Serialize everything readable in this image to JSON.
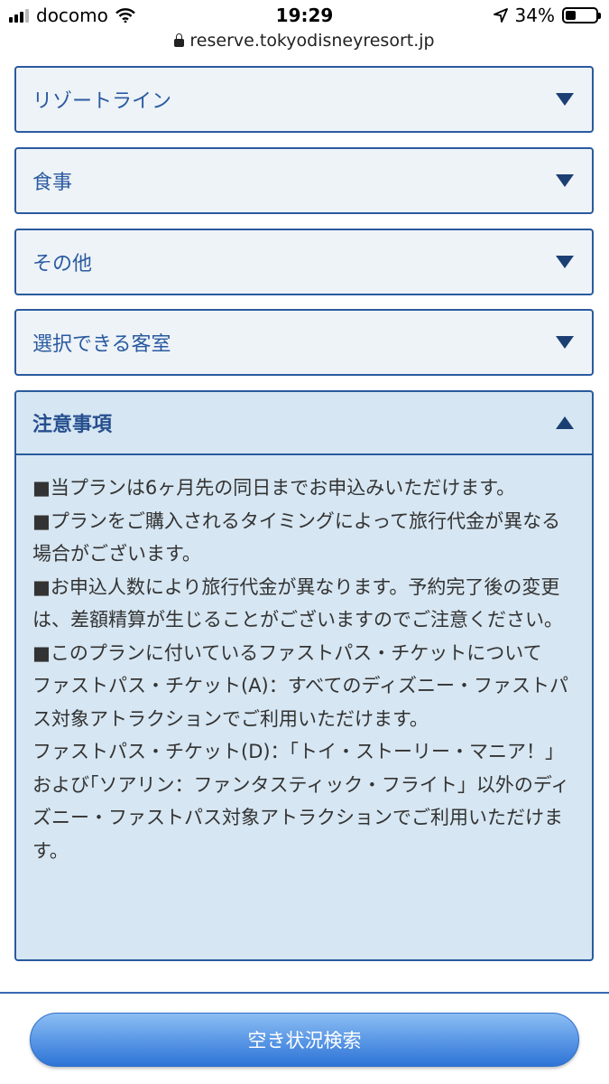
{
  "status_bar": {
    "carrier": "docomo",
    "time": "19:29",
    "battery": "34%",
    "battery_level": 0.34
  },
  "url_bar": {
    "url": "reserve.tokyodisneyresort.jp"
  },
  "accordions": [
    {
      "label": "リゾートライン",
      "expanded": false
    },
    {
      "label": "食事",
      "expanded": false
    },
    {
      "label": "その他",
      "expanded": false
    },
    {
      "label": "選択できる客室",
      "expanded": false
    },
    {
      "label": "注意事項",
      "expanded": true,
      "body": [
        "■当プランは6ヶ月先の同日までお申込みいただけます。",
        "■プランをご購入されるタイミングによって旅行代金が異なる場合がございます。",
        "■お申込人数により旅行代金が異なります。予約完了後の変更は、差額精算が生じることがございますのでご注意ください。",
        "■このプランに付いているファストパス・チケットについて",
        "ファストパス・チケット(A)：すべてのディズニー・ファストパス対象アトラクションでご利用いただけます。",
        "ファストパス・チケット(D)：「トイ・ストーリー・マニア！」および｢ソアリン：ファンタスティック・フライト」以外のディズニー・ファストパス対象アトラクションでご利用いただけます。"
      ]
    }
  ],
  "search_button": {
    "label": "空き状況検索"
  }
}
